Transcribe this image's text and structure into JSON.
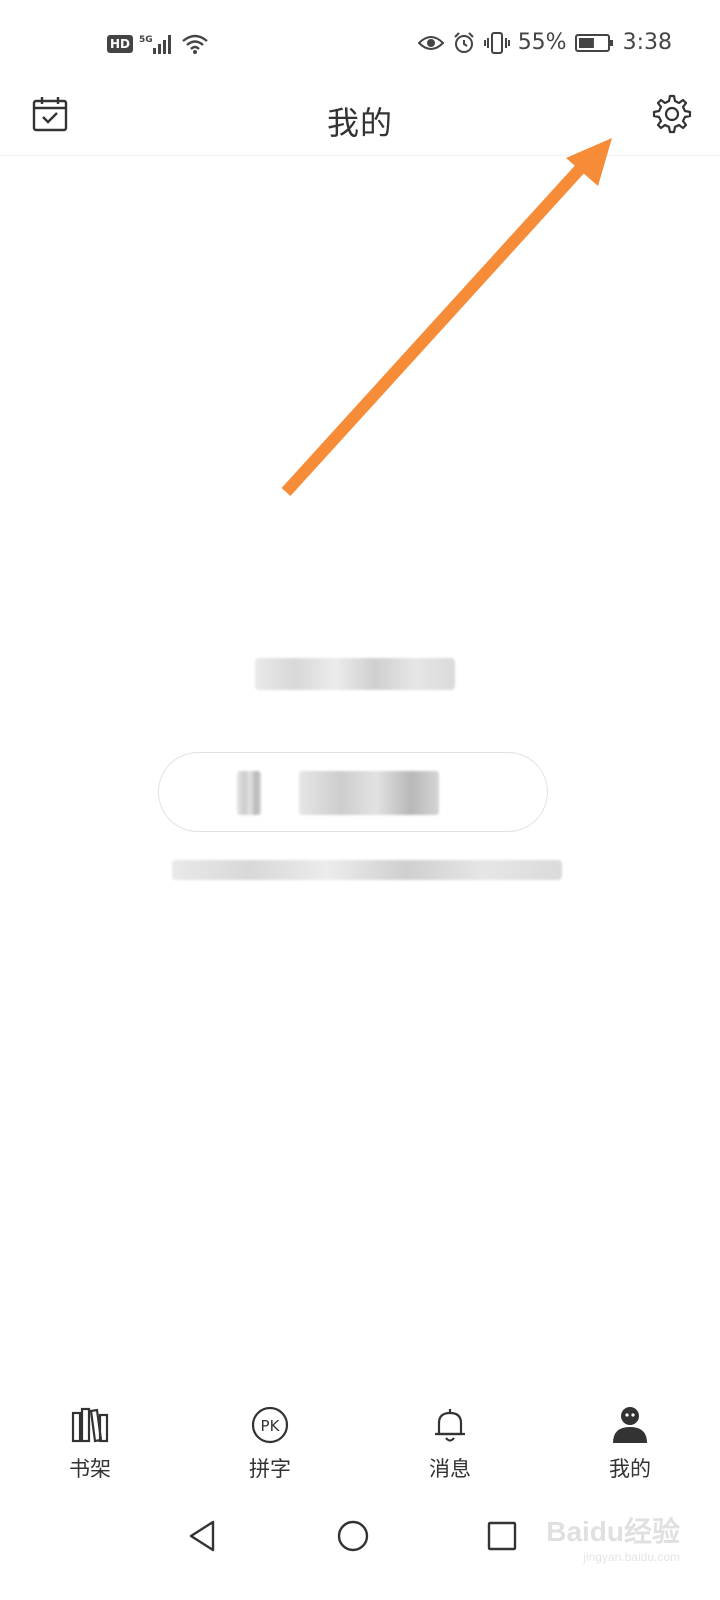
{
  "status_bar": {
    "badge": "HD",
    "network": "5G",
    "battery_percent": "55%",
    "battery_level": 0.55,
    "time": "3:38"
  },
  "header": {
    "title": "我的",
    "left_icon": "calendar-check-icon",
    "right_icon": "gear-icon"
  },
  "annotation": {
    "color": "#F68B38"
  },
  "tabs": [
    {
      "label": "书架",
      "icon": "bookshelf-icon"
    },
    {
      "label": "拼字",
      "icon": "pk-icon"
    },
    {
      "label": "消息",
      "icon": "bell-icon"
    },
    {
      "label": "我的",
      "icon": "person-icon",
      "active": true
    }
  ],
  "nav_bar": {
    "buttons": [
      "back-triangle-icon",
      "home-circle-icon",
      "recents-square-icon"
    ]
  },
  "watermark": {
    "logo": "Baidu经验",
    "sub": "jingyan.baidu.com"
  }
}
